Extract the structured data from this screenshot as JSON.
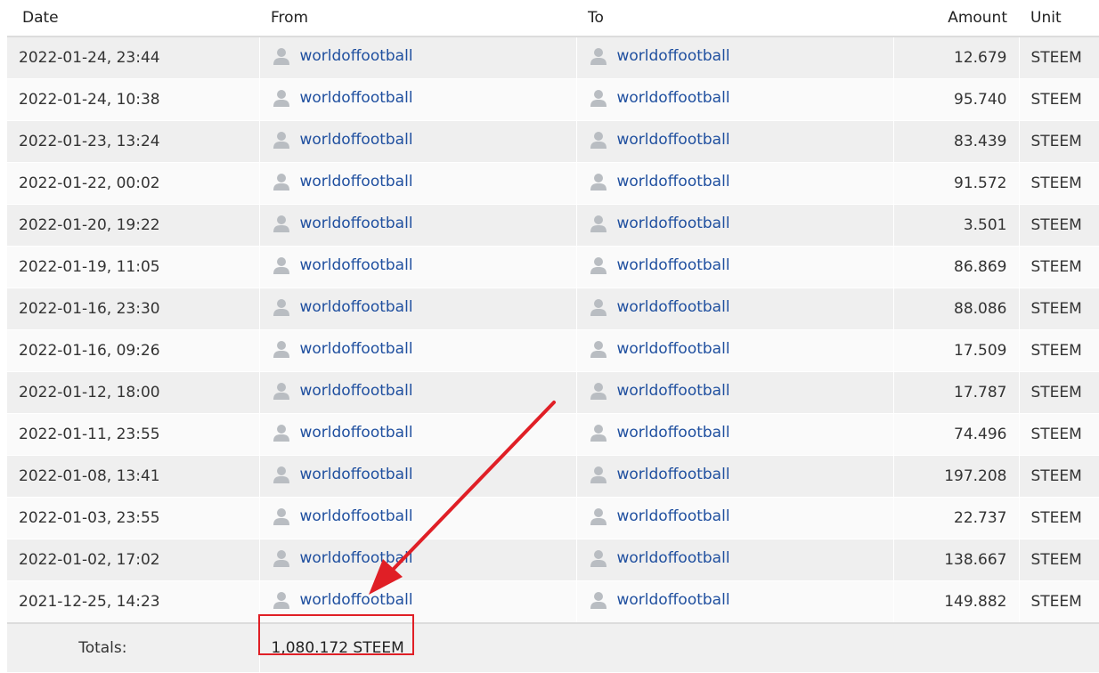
{
  "table": {
    "headers": {
      "date": "Date",
      "from": "From",
      "to": "To",
      "amount": "Amount",
      "unit": "Unit"
    },
    "rows": [
      {
        "date": "2022-01-24, 23:44",
        "from": "worldoffootball",
        "to": "worldoffootball",
        "amount": "12.679",
        "unit": "STEEM"
      },
      {
        "date": "2022-01-24, 10:38",
        "from": "worldoffootball",
        "to": "worldoffootball",
        "amount": "95.740",
        "unit": "STEEM"
      },
      {
        "date": "2022-01-23, 13:24",
        "from": "worldoffootball",
        "to": "worldoffootball",
        "amount": "83.439",
        "unit": "STEEM"
      },
      {
        "date": "2022-01-22, 00:02",
        "from": "worldoffootball",
        "to": "worldoffootball",
        "amount": "91.572",
        "unit": "STEEM"
      },
      {
        "date": "2022-01-20, 19:22",
        "from": "worldoffootball",
        "to": "worldoffootball",
        "amount": "3.501",
        "unit": "STEEM"
      },
      {
        "date": "2022-01-19, 11:05",
        "from": "worldoffootball",
        "to": "worldoffootball",
        "amount": "86.869",
        "unit": "STEEM"
      },
      {
        "date": "2022-01-16, 23:30",
        "from": "worldoffootball",
        "to": "worldoffootball",
        "amount": "88.086",
        "unit": "STEEM"
      },
      {
        "date": "2022-01-16, 09:26",
        "from": "worldoffootball",
        "to": "worldoffootball",
        "amount": "17.509",
        "unit": "STEEM"
      },
      {
        "date": "2022-01-12, 18:00",
        "from": "worldoffootball",
        "to": "worldoffootball",
        "amount": "17.787",
        "unit": "STEEM"
      },
      {
        "date": "2022-01-11, 23:55",
        "from": "worldoffootball",
        "to": "worldoffootball",
        "amount": "74.496",
        "unit": "STEEM"
      },
      {
        "date": "2022-01-08, 13:41",
        "from": "worldoffootball",
        "to": "worldoffootball",
        "amount": "197.208",
        "unit": "STEEM"
      },
      {
        "date": "2022-01-03, 23:55",
        "from": "worldoffootball",
        "to": "worldoffootball",
        "amount": "22.737",
        "unit": "STEEM"
      },
      {
        "date": "2022-01-02, 17:02",
        "from": "worldoffootball",
        "to": "worldoffootball",
        "amount": "138.667",
        "unit": "STEEM"
      },
      {
        "date": "2021-12-25, 14:23",
        "from": "worldoffootball",
        "to": "worldoffootball",
        "amount": "149.882",
        "unit": "STEEM"
      }
    ],
    "totals": {
      "label": "Totals:",
      "value": "1,080.172 STEEM"
    }
  },
  "annotations": {
    "highlight_color": "#e01f26",
    "arrow_icon": "red-arrow-icon"
  },
  "colors": {
    "link": "#1f4f9f",
    "row_odd": "#efefef",
    "row_even": "#fafafa",
    "icon": "#b9bdc2"
  }
}
